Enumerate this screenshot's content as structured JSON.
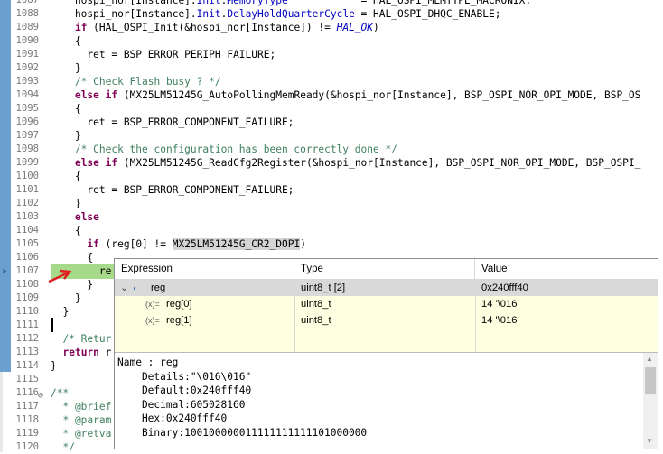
{
  "editor": {
    "lines": [
      {
        "n": "1087",
        "t": "    hospi_nor[Instance].Init.MemoryType            = HAL_OSPI_MEMTYPE_MACRONIX;"
      },
      {
        "n": "1088",
        "t": "    hospi_nor[Instance].Init.DelayHoldQuarterCycle = HAL_OSPI_DHQC_ENABLE;"
      },
      {
        "n": "1089",
        "t": "    if (HAL_OSPI_Init(&hospi_nor[Instance]) != HAL_OK)"
      },
      {
        "n": "1090",
        "t": "    {"
      },
      {
        "n": "1091",
        "t": "      ret = BSP_ERROR_PERIPH_FAILURE;"
      },
      {
        "n": "1092",
        "t": "    }"
      },
      {
        "n": "1093",
        "t": "    /* Check Flash busy ? */"
      },
      {
        "n": "1094",
        "t": "    else if (MX25LM51245G_AutoPollingMemReady(&hospi_nor[Instance], BSP_OSPI_NOR_OPI_MODE, BSP_OS"
      },
      {
        "n": "1095",
        "t": "    {"
      },
      {
        "n": "1096",
        "t": "      ret = BSP_ERROR_COMPONENT_FAILURE;"
      },
      {
        "n": "1097",
        "t": "    }"
      },
      {
        "n": "1098",
        "t": "    /* Check the configuration has been correctly done */"
      },
      {
        "n": "1099",
        "t": "    else if (MX25LM51245G_ReadCfg2Register(&hospi_nor[Instance], BSP_OSPI_NOR_OPI_MODE, BSP_OSPI_"
      },
      {
        "n": "1100",
        "t": "    {"
      },
      {
        "n": "1101",
        "t": "      ret = BSP_ERROR_COMPONENT_FAILURE;"
      },
      {
        "n": "1102",
        "t": "    }"
      },
      {
        "n": "1103",
        "t": "    else"
      },
      {
        "n": "1104",
        "t": "    {"
      },
      {
        "n": "1105",
        "t": "      if (reg[0] != MX25LM51245G_CR2_DOPI)"
      },
      {
        "n": "1106",
        "t": "      {"
      },
      {
        "n": "1107",
        "t": "        re"
      },
      {
        "n": "1108",
        "t": "      }"
      },
      {
        "n": "1109",
        "t": "    }"
      },
      {
        "n": "1110",
        "t": "  }"
      },
      {
        "n": "1111",
        "t": ""
      },
      {
        "n": "1112",
        "t": "  /* Retur"
      },
      {
        "n": "1113",
        "t": "  return r"
      },
      {
        "n": "1114",
        "t": "}"
      },
      {
        "n": "1115",
        "t": ""
      },
      {
        "n": "1116",
        "t": "/**"
      },
      {
        "n": "1117",
        "t": "  * @brief"
      },
      {
        "n": "1118",
        "t": "  * @param"
      },
      {
        "n": "1119",
        "t": "  * @retva"
      },
      {
        "n": "1120",
        "t": "  */"
      }
    ]
  },
  "hover": {
    "headers": {
      "expression": "Expression",
      "type": "Type",
      "value": "Value"
    },
    "rows": [
      {
        "toggle": "⌄",
        "name": "reg",
        "type": "uint8_t [2]",
        "value": "0x240fff40"
      },
      {
        "toggle": "",
        "name": "reg[0]",
        "type": "uint8_t",
        "value": "14 '\\016'"
      },
      {
        "toggle": "",
        "name": "reg[1]",
        "type": "uint8_t",
        "value": "14 '\\016'"
      }
    ],
    "details": "Name : reg\n    Details:\"\\016\\016\"\n    Default:0x240fff40\n    Decimal:605028160\n    Hex:0x240fff40\n    Binary:100100000011111111111101000000"
  },
  "colors": {
    "current_line": "#a7d98a",
    "popup_bg": "#ffffe1",
    "gutter": "#6b9fd0",
    "annotation": "#e02020"
  }
}
